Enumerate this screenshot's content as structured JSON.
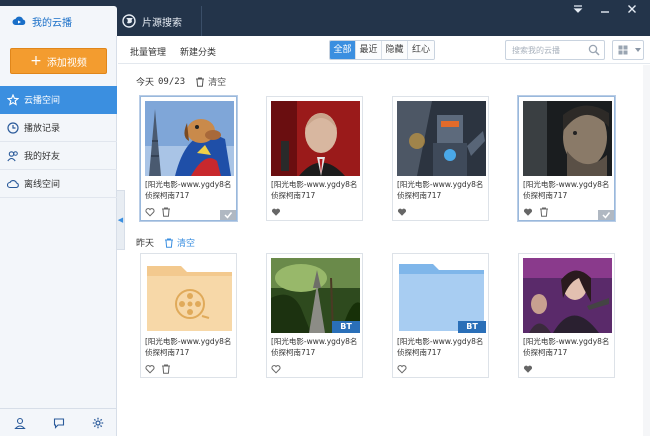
{
  "tabs": {
    "my_cloud": "我的云播",
    "source_search": "片源搜索"
  },
  "sidebar": {
    "add_video": "添加视频",
    "items": [
      {
        "label": "云播空间",
        "icon": "star-icon"
      },
      {
        "label": "播放记录",
        "icon": "clock-icon"
      },
      {
        "label": "我的好友",
        "icon": "friends-icon"
      },
      {
        "label": "离线空间",
        "icon": "cloud-offline-icon"
      }
    ]
  },
  "toolbar": {
    "batch_manage": "批量管理",
    "new_category": "新建分类",
    "filters": [
      "全部",
      "最近",
      "隐藏",
      "红心"
    ],
    "search_placeholder": "搜索我的云播"
  },
  "groups": [
    {
      "label": "今天",
      "date": "09/23",
      "clear": "清空",
      "items": [
        {
          "title": "[阳光电影-www.ygdy8名侦探柯南717",
          "selected": true
        },
        {
          "title": "[阳光电影-www.ygdy8名侦探柯南717",
          "selected": false
        },
        {
          "title": "[阳光电影-www.ygdy8名侦探柯南717",
          "selected": false
        },
        {
          "title": "[阳光电影-www.ygdy8名侦探柯南717",
          "selected": true
        }
      ]
    },
    {
      "label": "昨天",
      "date": "",
      "clear": "清空",
      "items": [
        {
          "title": "[阳光电影-www.ygdy8名侦探柯南717",
          "badge": ""
        },
        {
          "title": "[阳光电影-www.ygdy8名侦探柯南717",
          "badge": "BT"
        },
        {
          "title": "[阳光电影-www.ygdy8名侦探柯南717",
          "badge": "BT"
        },
        {
          "title": "[阳光电影-www.ygdy8名侦探柯南717",
          "badge": ""
        }
      ]
    }
  ],
  "colors": {
    "titlebar": "#23344a",
    "accent": "#3b8fe0",
    "add_button": "#f39c2f"
  }
}
